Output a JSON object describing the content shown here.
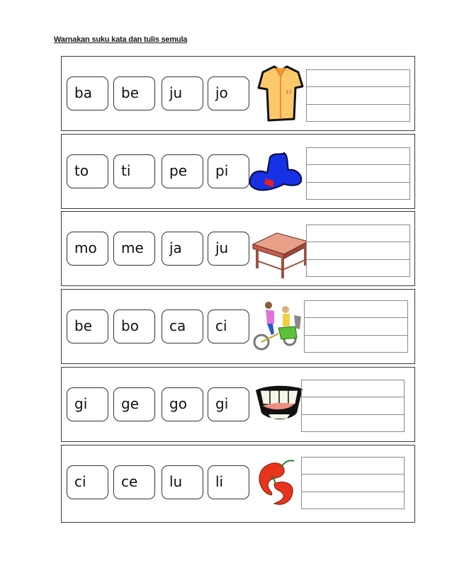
{
  "title": "Warnakan suku kata dan tulis semula",
  "rows": [
    {
      "syllables": [
        "ba",
        "be",
        "ju",
        "jo"
      ],
      "picture": "shirt",
      "answer_lines": 3
    },
    {
      "syllables": [
        "to",
        "ti",
        "pe",
        "pi"
      ],
      "picture": "hat",
      "answer_lines": 3
    },
    {
      "syllables": [
        "mo",
        "me",
        "ja",
        "ju"
      ],
      "picture": "table",
      "answer_lines": 3
    },
    {
      "syllables": [
        "be",
        "bo",
        "ca",
        "ci"
      ],
      "picture": "trishaw",
      "answer_lines": 3
    },
    {
      "syllables": [
        "gi",
        "ge",
        "go",
        "gi"
      ],
      "picture": "teeth",
      "answer_lines": 3
    },
    {
      "syllables": [
        "ci",
        "ce",
        "lu",
        "li"
      ],
      "picture": "chili",
      "answer_lines": 3
    }
  ]
}
